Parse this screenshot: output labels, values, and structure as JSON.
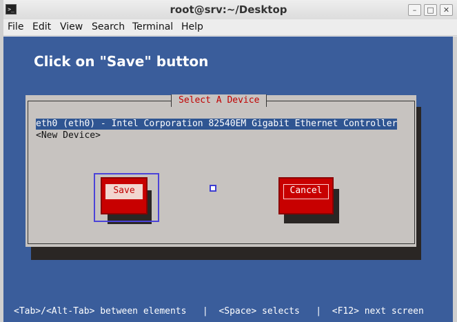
{
  "window": {
    "title": "root@srv:~/Desktop"
  },
  "menu": [
    "File",
    "Edit",
    "View",
    "Search",
    "Terminal",
    "Help"
  ],
  "instruction": "Click on \"Save\" button",
  "dialog": {
    "title": "Select A Device",
    "items": [
      {
        "label": "eth0 (eth0) - Intel Corporation 82540EM Gigabit Ethernet Controller",
        "selected": true
      },
      {
        "label": "<New Device>",
        "selected": false
      }
    ],
    "buttons": {
      "save": "Save",
      "cancel": "Cancel"
    }
  },
  "status": "<Tab>/<Alt-Tab> between elements   |  <Space> selects   |  <F12> next screen",
  "colors": {
    "terminal_bg": "#3a5d9b",
    "dialog_bg": "#c7c3c0",
    "button_red": "#c80000",
    "selection": "#2f5592",
    "highlight": "#4b43d8"
  }
}
